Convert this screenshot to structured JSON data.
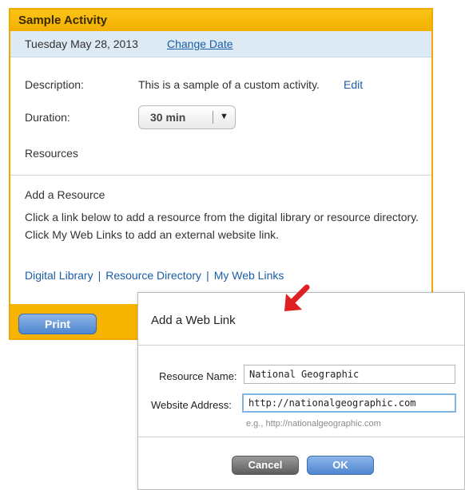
{
  "panel": {
    "title": "Sample Activity",
    "date": "Tuesday May 28, 2013",
    "change_date": "Change Date",
    "description_label": "Description:",
    "description": "This is a sample of a custom activity.",
    "edit": "Edit",
    "duration_label": "Duration:",
    "duration_value": "30 min",
    "resources_label": "Resources",
    "add_resource_title": "Add a Resource",
    "help_text": "Click a link below to add a resource from the digital library or resource directory. Click My Web Links to add an external website link.",
    "links": [
      "Digital Library",
      "Resource Directory",
      "My Web Links"
    ],
    "print": "Print"
  },
  "dialog": {
    "title": "Add a Web Link",
    "resource_name_label": "Resource Name:",
    "resource_name_value": "National Geographic",
    "website_label": "Website Address:",
    "website_value": "http://nationalgeographic.com",
    "hint": "e.g., http://nationalgeographic.com",
    "cancel": "Cancel",
    "ok": "OK"
  },
  "colors": {
    "accent": "#f6b400",
    "link": "#1a5ea8",
    "arrow": "#e02020"
  }
}
